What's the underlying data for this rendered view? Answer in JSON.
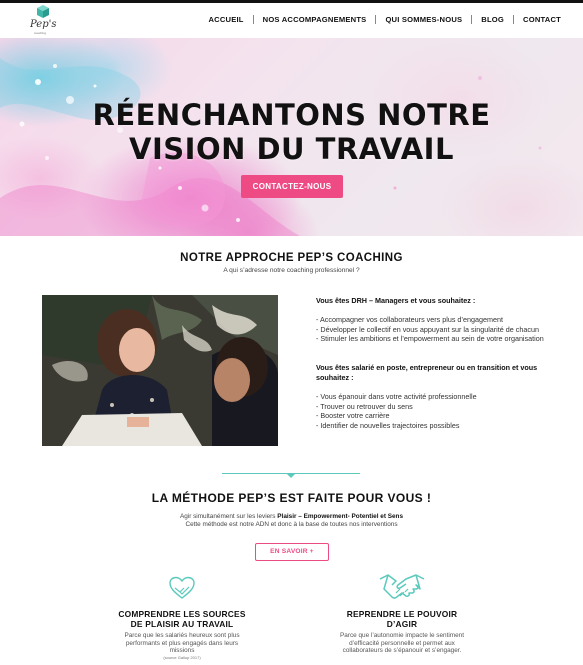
{
  "header": {
    "logo_text": "Pep's",
    "logo_sub": "coaching",
    "nav": [
      "ACCUEIL",
      "NOS ACCOMPAGNEMENTS",
      "QUI SOMMES-NOUS",
      "BLOG",
      "CONTACT"
    ]
  },
  "hero": {
    "title_line1": "RÉENCHANTONS NOTRE",
    "title_line2": "VISION DU TRAVAIL",
    "cta": "CONTACTEZ-NOUS"
  },
  "approach": {
    "title": "NOTRE APPROCHE PEP’S COACHING",
    "subtitle": "A qui s’adresse notre coaching professionnel ?",
    "block1_q": "Vous êtes DRH – Managers et vous souhaitez :",
    "block1_items": [
      "- Accompagner vos collaborateurs vers plus d’engagement",
      "- Développer le collectif en vous appuyant sur la singularité de chacun",
      "- Stimuler les ambitions et l’empowerment au sein de votre organisation"
    ],
    "block2_q": "Vous êtes salarié en poste, entrepreneur ou en transition et vous souhaitez :",
    "block2_items": [
      "- Vous épanouir dans votre activité professionnelle",
      "- Trouver ou retrouver du sens",
      "- Booster votre carrière",
      "- Identifier de nouvelles trajectoires possibles"
    ]
  },
  "method": {
    "title": "LA MÉTHODE PEP’S EST FAITE POUR VOUS !",
    "line1_prefix": "Agir simultanément sur les leviers ",
    "line1_bold": "Plaisir – Empowerment- Potentiel et Sens",
    "line2": "Cette méthode est notre ADN et donc à la base de toutes nos  interventions",
    "button": "EN SAVOIR +"
  },
  "features": [
    {
      "icon": "heart-hands-icon",
      "title_line1": "COMPRENDRE LES SOURCES",
      "title_line2": "DE PLAISIR AU TRAVAIL",
      "text_line1": "Parce que  les salariés heureux sont plus",
      "text_line2": "performants et plus engagés dans leurs",
      "text_line3": "missions",
      "source": "(source Gallup 2017)"
    },
    {
      "icon": "handshake-icon",
      "title_line1": "REPRENDRE LE POUVOIR",
      "title_line2": "D’AGIR",
      "text_line1": "Parce que l’autonomie impacte le sentiment",
      "text_line2": "d’efficacité personnelle et permet aux",
      "text_line3": "collaborateurs de s’épanouir et s’engager."
    }
  ],
  "colors": {
    "accent": "#ee4a84",
    "teal": "#5cc9bd"
  }
}
